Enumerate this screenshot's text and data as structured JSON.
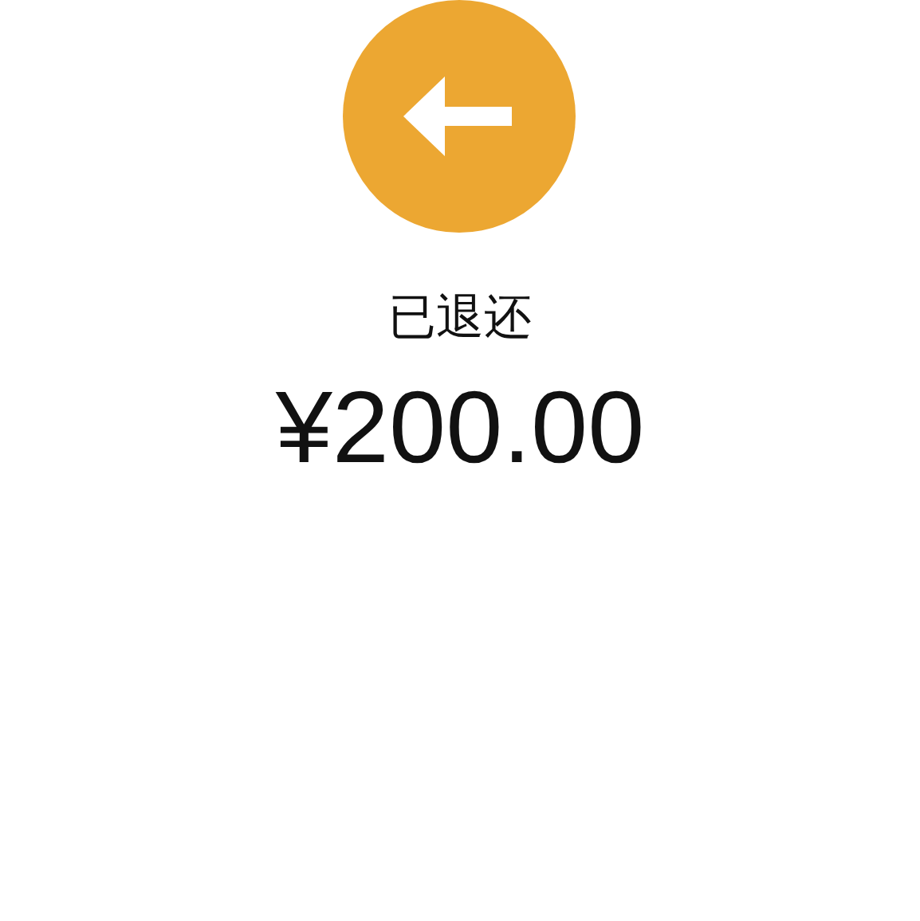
{
  "status": {
    "label": "已退还"
  },
  "amount": {
    "value": "¥200.00"
  }
}
